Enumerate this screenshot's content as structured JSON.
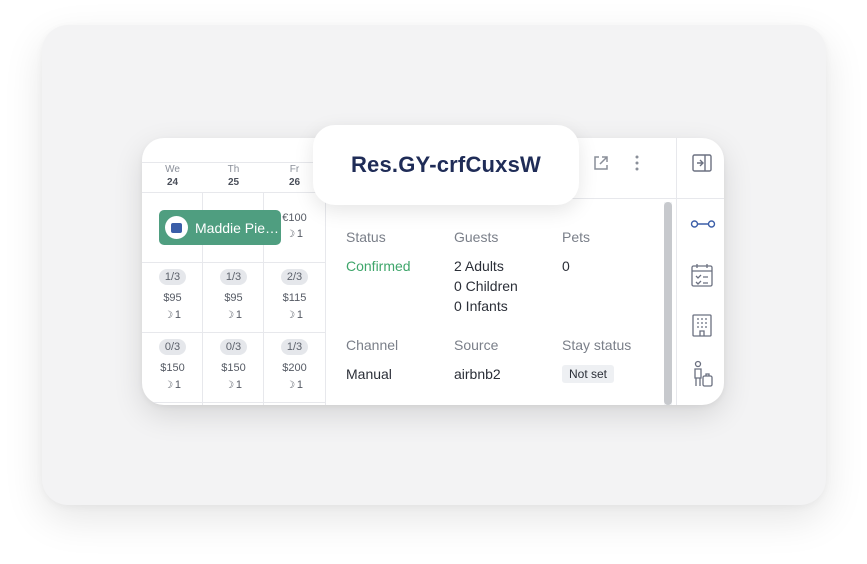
{
  "reservation": {
    "title": "Res.GY-crfCuxsW"
  },
  "calendar": {
    "days": [
      {
        "dow": "We",
        "date": "24"
      },
      {
        "dow": "Th",
        "date": "25"
      },
      {
        "dow": "Fr",
        "date": "26"
      }
    ],
    "booking": {
      "guest_name": "Maddie Pie…"
    },
    "friday_top": {
      "price": "€100",
      "nights": "1"
    },
    "rows": [
      [
        {
          "occupancy": "1/3",
          "price": "$95",
          "nights": "1"
        },
        {
          "occupancy": "1/3",
          "price": "$95",
          "nights": "1"
        },
        {
          "occupancy": "2/3",
          "price": "$115",
          "nights": "1"
        }
      ],
      [
        {
          "occupancy": "0/3",
          "price": "$150",
          "nights": "1"
        },
        {
          "occupancy": "0/3",
          "price": "$150",
          "nights": "1"
        },
        {
          "occupancy": "1/3",
          "price": "$200",
          "nights": "1"
        }
      ]
    ]
  },
  "details": {
    "status_label": "Status",
    "status_value": "Confirmed",
    "guests_label": "Guests",
    "guests_adults": "2 Adults",
    "guests_children": "0 Children",
    "guests_infants": "0 Infants",
    "pets_label": "Pets",
    "pets_value": "0",
    "channel_label": "Channel",
    "channel_value": "Manual",
    "source_label": "Source",
    "source_value": "airbnb2",
    "stay_status_label": "Stay status",
    "stay_status_value": "Not set"
  },
  "icons": {
    "open_external": "open-external-icon",
    "more": "more-vertical-icon",
    "collapse_panel": "collapse-panel-icon",
    "timeline": "timeline-icon",
    "checklist": "calendar-checklist-icon",
    "property": "building-icon",
    "traveler": "traveler-icon"
  },
  "colors": {
    "booking": "#4f9e80",
    "confirmed": "#3fa66b",
    "accent": "#3b5ea8",
    "title": "#1f2c57"
  }
}
